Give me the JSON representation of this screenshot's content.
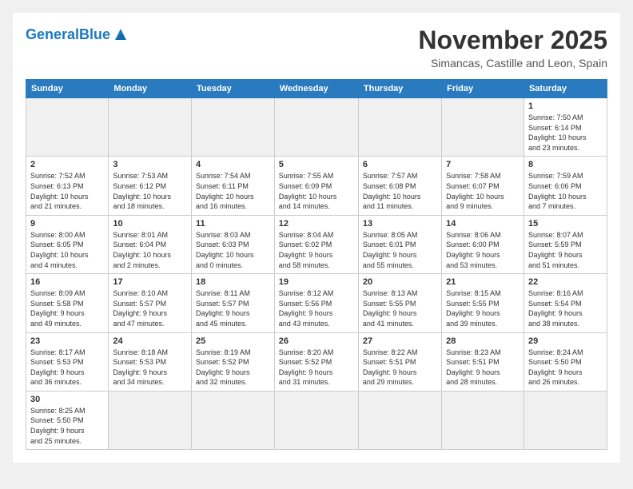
{
  "header": {
    "logo_general": "General",
    "logo_blue": "Blue",
    "month_title": "November 2025",
    "subtitle": "Simancas, Castille and Leon, Spain"
  },
  "days_of_week": [
    "Sunday",
    "Monday",
    "Tuesday",
    "Wednesday",
    "Thursday",
    "Friday",
    "Saturday"
  ],
  "weeks": [
    [
      {
        "day": "",
        "info": ""
      },
      {
        "day": "",
        "info": ""
      },
      {
        "day": "",
        "info": ""
      },
      {
        "day": "",
        "info": ""
      },
      {
        "day": "",
        "info": ""
      },
      {
        "day": "",
        "info": ""
      },
      {
        "day": "1",
        "info": "Sunrise: 7:50 AM\nSunset: 6:14 PM\nDaylight: 10 hours\nand 23 minutes."
      }
    ],
    [
      {
        "day": "2",
        "info": "Sunrise: 7:52 AM\nSunset: 6:13 PM\nDaylight: 10 hours\nand 21 minutes."
      },
      {
        "day": "3",
        "info": "Sunrise: 7:53 AM\nSunset: 6:12 PM\nDaylight: 10 hours\nand 18 minutes."
      },
      {
        "day": "4",
        "info": "Sunrise: 7:54 AM\nSunset: 6:11 PM\nDaylight: 10 hours\nand 16 minutes."
      },
      {
        "day": "5",
        "info": "Sunrise: 7:55 AM\nSunset: 6:09 PM\nDaylight: 10 hours\nand 14 minutes."
      },
      {
        "day": "6",
        "info": "Sunrise: 7:57 AM\nSunset: 6:08 PM\nDaylight: 10 hours\nand 11 minutes."
      },
      {
        "day": "7",
        "info": "Sunrise: 7:58 AM\nSunset: 6:07 PM\nDaylight: 10 hours\nand 9 minutes."
      },
      {
        "day": "8",
        "info": "Sunrise: 7:59 AM\nSunset: 6:06 PM\nDaylight: 10 hours\nand 7 minutes."
      }
    ],
    [
      {
        "day": "9",
        "info": "Sunrise: 8:00 AM\nSunset: 6:05 PM\nDaylight: 10 hours\nand 4 minutes."
      },
      {
        "day": "10",
        "info": "Sunrise: 8:01 AM\nSunset: 6:04 PM\nDaylight: 10 hours\nand 2 minutes."
      },
      {
        "day": "11",
        "info": "Sunrise: 8:03 AM\nSunset: 6:03 PM\nDaylight: 10 hours\nand 0 minutes."
      },
      {
        "day": "12",
        "info": "Sunrise: 8:04 AM\nSunset: 6:02 PM\nDaylight: 9 hours\nand 58 minutes."
      },
      {
        "day": "13",
        "info": "Sunrise: 8:05 AM\nSunset: 6:01 PM\nDaylight: 9 hours\nand 55 minutes."
      },
      {
        "day": "14",
        "info": "Sunrise: 8:06 AM\nSunset: 6:00 PM\nDaylight: 9 hours\nand 53 minutes."
      },
      {
        "day": "15",
        "info": "Sunrise: 8:07 AM\nSunset: 5:59 PM\nDaylight: 9 hours\nand 51 minutes."
      }
    ],
    [
      {
        "day": "16",
        "info": "Sunrise: 8:09 AM\nSunset: 5:58 PM\nDaylight: 9 hours\nand 49 minutes."
      },
      {
        "day": "17",
        "info": "Sunrise: 8:10 AM\nSunset: 5:57 PM\nDaylight: 9 hours\nand 47 minutes."
      },
      {
        "day": "18",
        "info": "Sunrise: 8:11 AM\nSunset: 5:57 PM\nDaylight: 9 hours\nand 45 minutes."
      },
      {
        "day": "19",
        "info": "Sunrise: 8:12 AM\nSunset: 5:56 PM\nDaylight: 9 hours\nand 43 minutes."
      },
      {
        "day": "20",
        "info": "Sunrise: 8:13 AM\nSunset: 5:55 PM\nDaylight: 9 hours\nand 41 minutes."
      },
      {
        "day": "21",
        "info": "Sunrise: 8:15 AM\nSunset: 5:55 PM\nDaylight: 9 hours\nand 39 minutes."
      },
      {
        "day": "22",
        "info": "Sunrise: 8:16 AM\nSunset: 5:54 PM\nDaylight: 9 hours\nand 38 minutes."
      }
    ],
    [
      {
        "day": "23",
        "info": "Sunrise: 8:17 AM\nSunset: 5:53 PM\nDaylight: 9 hours\nand 36 minutes."
      },
      {
        "day": "24",
        "info": "Sunrise: 8:18 AM\nSunset: 5:53 PM\nDaylight: 9 hours\nand 34 minutes."
      },
      {
        "day": "25",
        "info": "Sunrise: 8:19 AM\nSunset: 5:52 PM\nDaylight: 9 hours\nand 32 minutes."
      },
      {
        "day": "26",
        "info": "Sunrise: 8:20 AM\nSunset: 5:52 PM\nDaylight: 9 hours\nand 31 minutes."
      },
      {
        "day": "27",
        "info": "Sunrise: 8:22 AM\nSunset: 5:51 PM\nDaylight: 9 hours\nand 29 minutes."
      },
      {
        "day": "28",
        "info": "Sunrise: 8:23 AM\nSunset: 5:51 PM\nDaylight: 9 hours\nand 28 minutes."
      },
      {
        "day": "29",
        "info": "Sunrise: 8:24 AM\nSunset: 5:50 PM\nDaylight: 9 hours\nand 26 minutes."
      }
    ],
    [
      {
        "day": "30",
        "info": "Sunrise: 8:25 AM\nSunset: 5:50 PM\nDaylight: 9 hours\nand 25 minutes."
      },
      {
        "day": "",
        "info": ""
      },
      {
        "day": "",
        "info": ""
      },
      {
        "day": "",
        "info": ""
      },
      {
        "day": "",
        "info": ""
      },
      {
        "day": "",
        "info": ""
      },
      {
        "day": "",
        "info": ""
      }
    ]
  ]
}
